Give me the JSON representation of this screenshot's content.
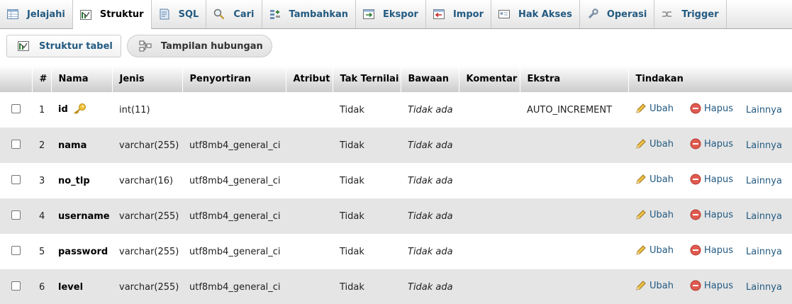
{
  "tabs": [
    {
      "label": "Jelajahi",
      "icon": "browse-icon",
      "active": false
    },
    {
      "label": "Struktur",
      "icon": "structure-icon",
      "active": true
    },
    {
      "label": "SQL",
      "icon": "sql-icon",
      "active": false
    },
    {
      "label": "Cari",
      "icon": "search-icon",
      "active": false
    },
    {
      "label": "Tambahkan",
      "icon": "insert-icon",
      "active": false
    },
    {
      "label": "Ekspor",
      "icon": "export-icon",
      "active": false
    },
    {
      "label": "Impor",
      "icon": "import-icon",
      "active": false
    },
    {
      "label": "Hak Akses",
      "icon": "privileges-icon",
      "active": false
    },
    {
      "label": "Operasi",
      "icon": "operations-icon",
      "active": false
    },
    {
      "label": "Trigger",
      "icon": "trigger-icon",
      "active": false
    }
  ],
  "subnav": {
    "structure_label": "Struktur tabel",
    "relation_label": "Tampilan hubungan"
  },
  "table": {
    "headers": {
      "num": "#",
      "name": "Nama",
      "type": "Jenis",
      "collation": "Penyortiran",
      "attributes": "Atribut",
      "null": "Tak Ternilai",
      "default": "Bawaan",
      "comment": "Komentar",
      "extra": "Ekstra",
      "action": "Tindakan"
    },
    "actions": {
      "change": "Ubah",
      "drop": "Hapus",
      "more": "Lainnya"
    },
    "rows": [
      {
        "num": "1",
        "name": "id",
        "type": "int(11)",
        "collation": "",
        "attributes": "",
        "null": "Tidak",
        "default": "Tidak ada",
        "comment": "",
        "extra": "AUTO_INCREMENT",
        "primary_key": true
      },
      {
        "num": "2",
        "name": "nama",
        "type": "varchar(255)",
        "collation": "utf8mb4_general_ci",
        "attributes": "",
        "null": "Tidak",
        "default": "Tidak ada",
        "comment": "",
        "extra": "",
        "primary_key": false
      },
      {
        "num": "3",
        "name": "no_tlp",
        "type": "varchar(16)",
        "collation": "utf8mb4_general_ci",
        "attributes": "",
        "null": "Tidak",
        "default": "Tidak ada",
        "comment": "",
        "extra": "",
        "primary_key": false
      },
      {
        "num": "4",
        "name": "username",
        "type": "varchar(255)",
        "collation": "utf8mb4_general_ci",
        "attributes": "",
        "null": "Tidak",
        "default": "Tidak ada",
        "comment": "",
        "extra": "",
        "primary_key": false
      },
      {
        "num": "5",
        "name": "password",
        "type": "varchar(255)",
        "collation": "utf8mb4_general_ci",
        "attributes": "",
        "null": "Tidak",
        "default": "Tidak ada",
        "comment": "",
        "extra": "",
        "primary_key": false
      },
      {
        "num": "6",
        "name": "level",
        "type": "varchar(255)",
        "collation": "utf8mb4_general_ci",
        "attributes": "",
        "null": "Tidak",
        "default": "Tidak ada",
        "comment": "",
        "extra": "",
        "primary_key": false
      }
    ]
  }
}
